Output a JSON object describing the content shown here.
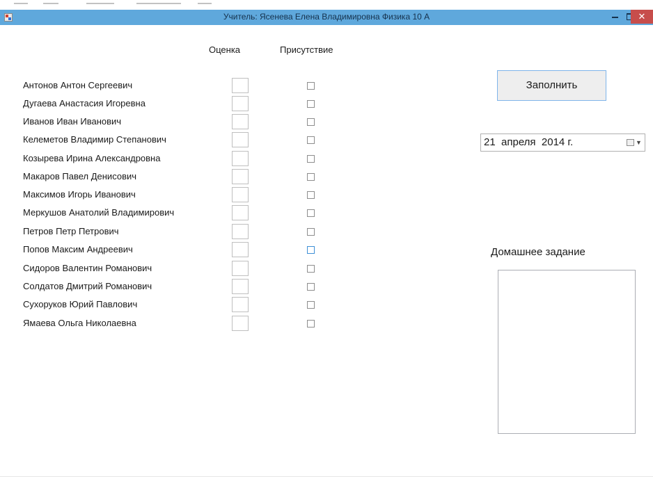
{
  "window": {
    "title": "Учитель: Ясенева Елена Владимировна Физика 10 А",
    "close_glyph": "✕"
  },
  "headers": {
    "grade": "Оценка",
    "presence": "Присутствие"
  },
  "students": [
    "Антонов Антон Сергеевич",
    "Дугаева Анастасия Игоревна",
    "Иванов Иван Иванович",
    "Келеметов Владимир Степанович",
    "Козырева Ирина Александровна",
    "Макаров Павел Денисович",
    "Максимов Игорь Иванович",
    "Меркушов Анатолий Владимирович",
    "Петров Петр Петрович",
    "Попов Максим Андреевич",
    "Сидоров Валентин Романович",
    "Солдатов Дмитрий Романович",
    "Сухоруков Юрий Павлович",
    "Ямаева Ольга Николаевна"
  ],
  "actions": {
    "fill_label": "Заполнить"
  },
  "date": {
    "value": "21  апреля  2014 г."
  },
  "homework": {
    "label": "Домашнее задание",
    "value": ""
  },
  "colors": {
    "titlebar": "#5fa8dc",
    "close": "#c74d4b",
    "accent_border": "#7eb4ea"
  }
}
